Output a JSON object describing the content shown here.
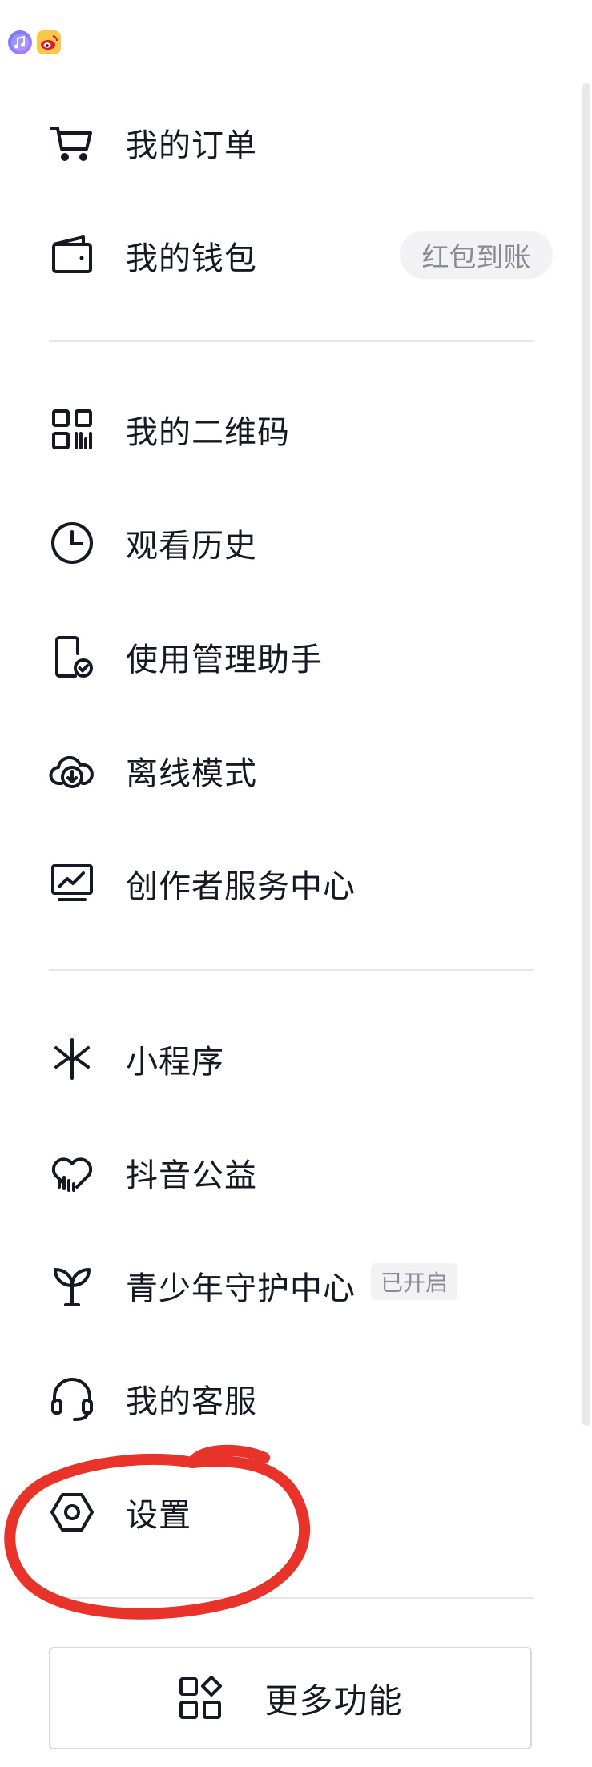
{
  "menu": {
    "items": [
      {
        "id": "orders",
        "icon": "cart-icon",
        "label": "我的订单"
      },
      {
        "id": "wallet",
        "icon": "wallet-icon",
        "label": "我的钱包",
        "badge": "红包到账"
      },
      {
        "id": "qrcode",
        "icon": "qrcode-icon",
        "label": "我的二维码"
      },
      {
        "id": "history",
        "icon": "clock-icon",
        "label": "观看历史"
      },
      {
        "id": "usage",
        "icon": "phone-check-icon",
        "label": "使用管理助手"
      },
      {
        "id": "offline",
        "icon": "cloud-download-icon",
        "label": "离线模式"
      },
      {
        "id": "creator",
        "icon": "monitor-chart-icon",
        "label": "创作者服务中心"
      },
      {
        "id": "miniapp",
        "icon": "miniapp-icon",
        "label": "小程序"
      },
      {
        "id": "charity",
        "icon": "heart-chart-icon",
        "label": "抖音公益"
      },
      {
        "id": "youth",
        "icon": "sprout-icon",
        "label": "青少年守护中心",
        "tag": "已开启"
      },
      {
        "id": "service",
        "icon": "headset-icon",
        "label": "我的客服"
      },
      {
        "id": "settings",
        "icon": "hexagon-settings-icon",
        "label": "设置"
      }
    ]
  },
  "more_button": {
    "icon": "grid-diamond-icon",
    "label": "更多功能"
  },
  "status_icons": [
    "music-app-icon",
    "weibo-app-icon"
  ],
  "annotation": {
    "color": "#e8332a"
  }
}
